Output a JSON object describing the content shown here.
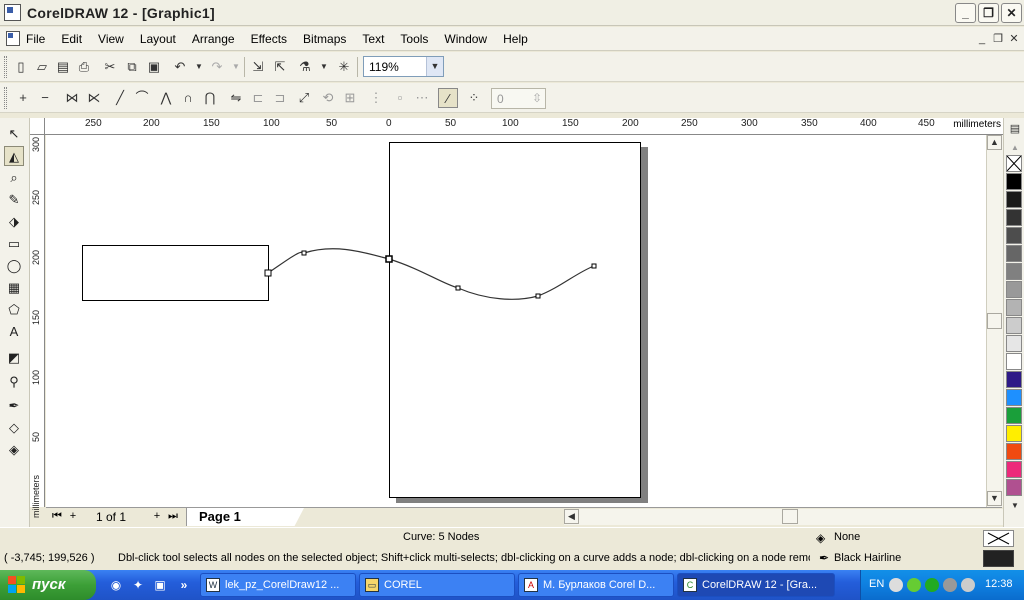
{
  "window": {
    "title": "CorelDRAW 12 - [Graphic1]",
    "minimize": "_",
    "maximize": "❐",
    "close": "✕"
  },
  "menu": {
    "items": [
      "File",
      "Edit",
      "View",
      "Layout",
      "Arrange",
      "Effects",
      "Bitmaps",
      "Text",
      "Tools",
      "Window",
      "Help"
    ],
    "doc_minimize": "_",
    "doc_restore": "❐",
    "doc_close": "✕"
  },
  "toolbar": {
    "zoom_value": "119%",
    "nudge_value": "0"
  },
  "rulers": {
    "unit": "millimeters",
    "top_labels": [
      "250",
      "200",
      "150",
      "100",
      "50",
      "0",
      "50",
      "100",
      "150",
      "200",
      "250",
      "300",
      "350",
      "400",
      "450"
    ],
    "left_labels": [
      "300",
      "250",
      "200",
      "150",
      "100",
      "50"
    ]
  },
  "pagebar": {
    "count": "1 of 1",
    "tab_label": "Page 1"
  },
  "status": {
    "curve_info": "Curve: 5 Nodes",
    "coords": "( -3,745; 199,526 )",
    "hint": "Dbl-click tool selects all nodes on the selected object; Shift+click multi-selects; dbl-clicking on a curve adds a node; dbl-clicking on a node remo...",
    "fill_label": "None",
    "outline_label": "Black  Hairline"
  },
  "palette": {
    "colors": [
      "#ffffff",
      "#000000",
      "#1a1a1a",
      "#333333",
      "#4d4d4d",
      "#666666",
      "#808080",
      "#999999",
      "#b3b3b3",
      "#cccccc",
      "#e6e6e6",
      "#ffffff",
      "#2e1a87",
      "#1e90ff",
      "#1a9f3a",
      "#ffee00",
      "#f04a10",
      "#ec2a7a",
      "#b05090"
    ]
  },
  "taskbar": {
    "start_label": "пуск",
    "tasks": [
      {
        "label": "lek_pz_CorelDraw12 ...",
        "icon": "W"
      },
      {
        "label": "COREL",
        "icon": "▭"
      },
      {
        "label": "М. Бурлаков Corel D...",
        "icon": "A"
      },
      {
        "label": "CorelDRAW 12 - [Gra...",
        "icon": "C"
      }
    ],
    "lang": "EN",
    "clock": "12:38"
  }
}
